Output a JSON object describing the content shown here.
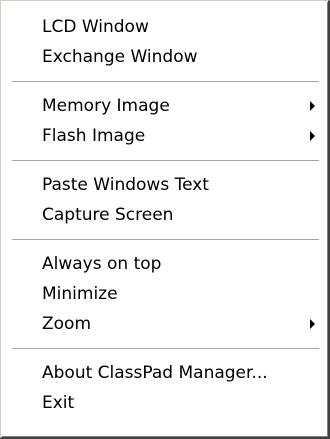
{
  "menu": {
    "groups": [
      {
        "items": [
          {
            "label": "LCD Window"
          },
          {
            "label": "Exchange Window"
          }
        ]
      },
      {
        "items": [
          {
            "label": "Memory Image",
            "submenu": true
          },
          {
            "label": "Flash Image",
            "submenu": true
          }
        ]
      },
      {
        "items": [
          {
            "label": "Paste Windows Text"
          },
          {
            "label": "Capture Screen"
          }
        ]
      },
      {
        "items": [
          {
            "label": "Always on top"
          },
          {
            "label": "Minimize"
          },
          {
            "label": "Zoom",
            "submenu": true
          }
        ]
      },
      {
        "items": [
          {
            "label": "About ClassPad Manager..."
          },
          {
            "label": "Exit"
          }
        ]
      }
    ],
    "colors": {
      "background": "#ffffff",
      "separator": "#aca899",
      "text": "#000000"
    },
    "submenu_icon": "submenu-arrow-icon"
  }
}
